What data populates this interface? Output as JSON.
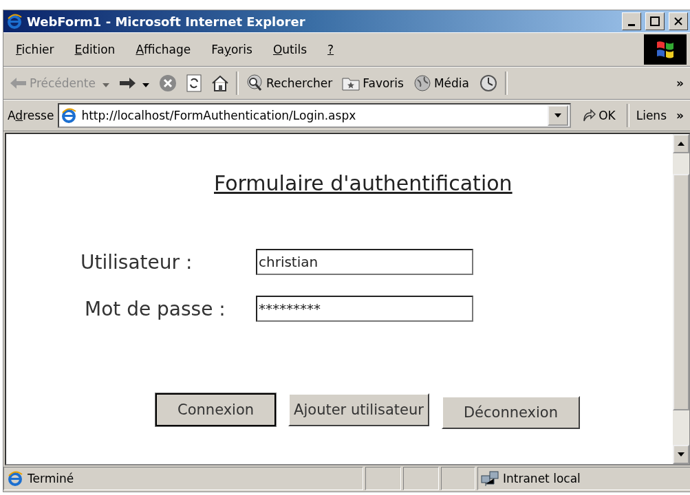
{
  "window": {
    "title": "WebForm1 - Microsoft Internet Explorer"
  },
  "menu": [
    {
      "key": "F",
      "post": "ichier"
    },
    {
      "key": "E",
      "post": "dition"
    },
    {
      "key": "A",
      "post": "ffichage"
    },
    {
      "pre": "Fa",
      "key": "y",
      "post": "oris"
    },
    {
      "key": "O",
      "post": "utils"
    },
    {
      "key": "?"
    }
  ],
  "toolbar": [
    {
      "kind": "back",
      "label": "Précédente",
      "disabled": true
    },
    {
      "kind": "forward",
      "disabled": false
    },
    {
      "kind": "stop"
    },
    {
      "kind": "refresh"
    },
    {
      "kind": "home"
    },
    {
      "kind": "separator"
    },
    {
      "kind": "search",
      "label": "Rechercher"
    },
    {
      "kind": "favorites",
      "label": "Favoris"
    },
    {
      "kind": "media",
      "label": "Média"
    },
    {
      "kind": "history"
    },
    {
      "kind": "separator"
    }
  ],
  "toolbar_more": "»",
  "address": {
    "label_parts": [
      "A",
      "d",
      "resse"
    ],
    "url": "http://localhost/FormAuthentication/Login.aspx",
    "go": "OK",
    "links": "Liens",
    "links_more": "»"
  },
  "page": {
    "heading": "Formulaire d'authentification",
    "fields": [
      {
        "label": "Utilisateur :",
        "value": "christian"
      },
      {
        "label": "Mot de passe :",
        "value": "*********"
      }
    ],
    "buttons": [
      {
        "label": "Connexion",
        "default": true
      },
      {
        "label": "Ajouter utilisateur",
        "default": false
      },
      {
        "label": "Déconnexion",
        "default": false
      }
    ]
  },
  "status_bar": {
    "text": "Terminé",
    "zone": "Intranet local"
  }
}
